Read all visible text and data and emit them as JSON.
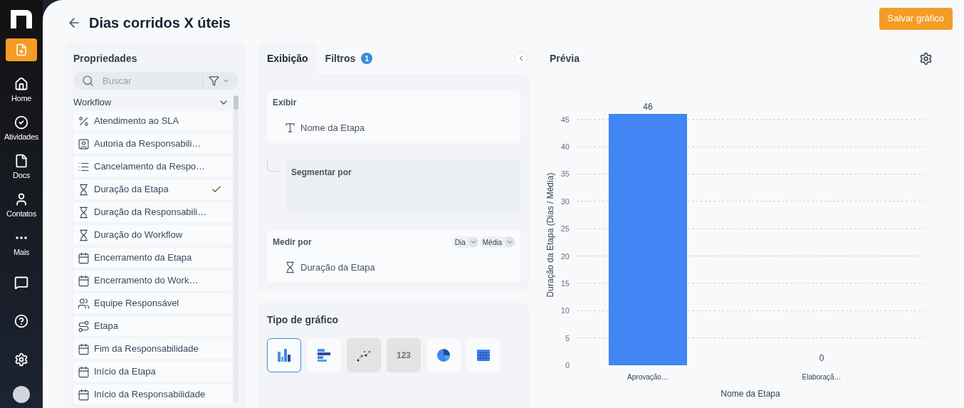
{
  "nav": [
    {
      "kind": "new"
    },
    {
      "kind": "home",
      "label": "Home"
    },
    {
      "kind": "tasks",
      "label": "Atividades"
    },
    {
      "kind": "docs",
      "label": "Docs"
    },
    {
      "kind": "contacts",
      "label": "Contatos"
    },
    {
      "kind": "more",
      "label": "Mais"
    },
    {
      "kind": "chat"
    },
    {
      "kind": "help"
    },
    {
      "kind": "settings"
    },
    {
      "kind": "avatar"
    }
  ],
  "header": {
    "title": "Dias corridos X úteis",
    "save_button": "Salvar gráfico"
  },
  "properties": {
    "title": "Propriedades",
    "search": {
      "placeholder": "Buscar"
    },
    "group": {
      "label": "Workflow",
      "expanded": true
    },
    "items": [
      {
        "kind": "sla",
        "label": "Atendimento ao SLA",
        "checked": false
      },
      {
        "kind": "person",
        "label": "Autoria da Responsabili…",
        "checked": false
      },
      {
        "kind": "list",
        "label": "Cancelamento da Respo…",
        "checked": false
      },
      {
        "kind": "duration",
        "label": "Duração da Etapa",
        "checked": true
      },
      {
        "kind": "duration",
        "label": "Duração da Responsabili…",
        "checked": false
      },
      {
        "kind": "duration",
        "label": "Duração do Workflow",
        "checked": false
      },
      {
        "kind": "date",
        "label": "Encerramento da Etapa",
        "checked": false
      },
      {
        "kind": "date",
        "label": "Encerramento do Work…",
        "checked": false
      },
      {
        "kind": "team",
        "label": "Equipe Responsável",
        "checked": false
      },
      {
        "kind": "stage",
        "label": "Etapa",
        "checked": false
      },
      {
        "kind": "date",
        "label": "Fim da Responsabilidade",
        "checked": false
      },
      {
        "kind": "date",
        "label": "Início da Etapa",
        "checked": false
      },
      {
        "kind": "date",
        "label": "Início da Responsabilidade",
        "checked": false
      }
    ]
  },
  "config": {
    "tabs": [
      {
        "label": "Exibição",
        "selected": true
      },
      {
        "label": "Filtros",
        "selected": false,
        "badge": "1"
      }
    ],
    "show": {
      "title": "Exibir",
      "field": {
        "kind": "text",
        "label": "Nome da Etapa"
      }
    },
    "segment": {
      "title": "Segmentar por"
    },
    "measure": {
      "title": "Medir por",
      "unit": "Dia",
      "aggregation": "Média",
      "field": {
        "kind": "duration",
        "label": "Duração da Etapa"
      }
    },
    "chart_types": {
      "title": "Tipo de gráfico",
      "items": [
        {
          "kind": "column",
          "selected": true,
          "disabled": false
        },
        {
          "kind": "bar",
          "selected": false,
          "disabled": false
        },
        {
          "kind": "scatter",
          "selected": false,
          "disabled": true
        },
        {
          "kind": "number",
          "label": "123",
          "selected": false,
          "disabled": true
        },
        {
          "kind": "pie",
          "selected": false,
          "disabled": false
        },
        {
          "kind": "table",
          "selected": false,
          "disabled": false
        }
      ]
    }
  },
  "preview": {
    "title": "Prévia",
    "chart_data": {
      "type": "bar",
      "xlabel": "Nome da Etapa",
      "ylabel": "Duração da Etapa (Dias / Média)",
      "categories": [
        "Aprovação…",
        "Elaboraçã…"
      ],
      "series": [
        {
          "color": "#4285f4",
          "values": [
            46,
            0
          ]
        }
      ],
      "ylim": [
        0,
        46
      ],
      "grid": true,
      "yticks": [
        0,
        5,
        10,
        15,
        20,
        25,
        30,
        35,
        40,
        45
      ],
      "data_labels": true
    }
  }
}
